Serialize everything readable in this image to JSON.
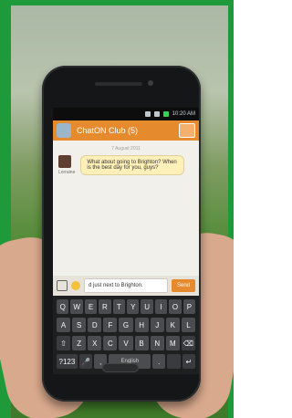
{
  "phone": {
    "time": "10:20 AM"
  },
  "chat": {
    "title": "ChatON Club (5)",
    "date_divider": "7 August 2011",
    "message_text": "What about going to Brighton? When is the best day for you, guys?",
    "sender_label": "Lorraine"
  },
  "composer": {
    "input_text": "d just next to Brighton.",
    "send_label": "Send"
  },
  "keyboard": {
    "row1": [
      "Q",
      "W",
      "E",
      "R",
      "T",
      "Y",
      "U",
      "I",
      "O",
      "P"
    ],
    "row2": [
      "A",
      "S",
      "D",
      "F",
      "G",
      "H",
      "J",
      "K",
      "L"
    ],
    "row3": [
      "⇧",
      "Z",
      "X",
      "C",
      "V",
      "B",
      "N",
      "M",
      "⌫"
    ],
    "row4": [
      "?123",
      "🎤",
      ",",
      "English",
      ".",
      " ",
      "↵"
    ]
  }
}
